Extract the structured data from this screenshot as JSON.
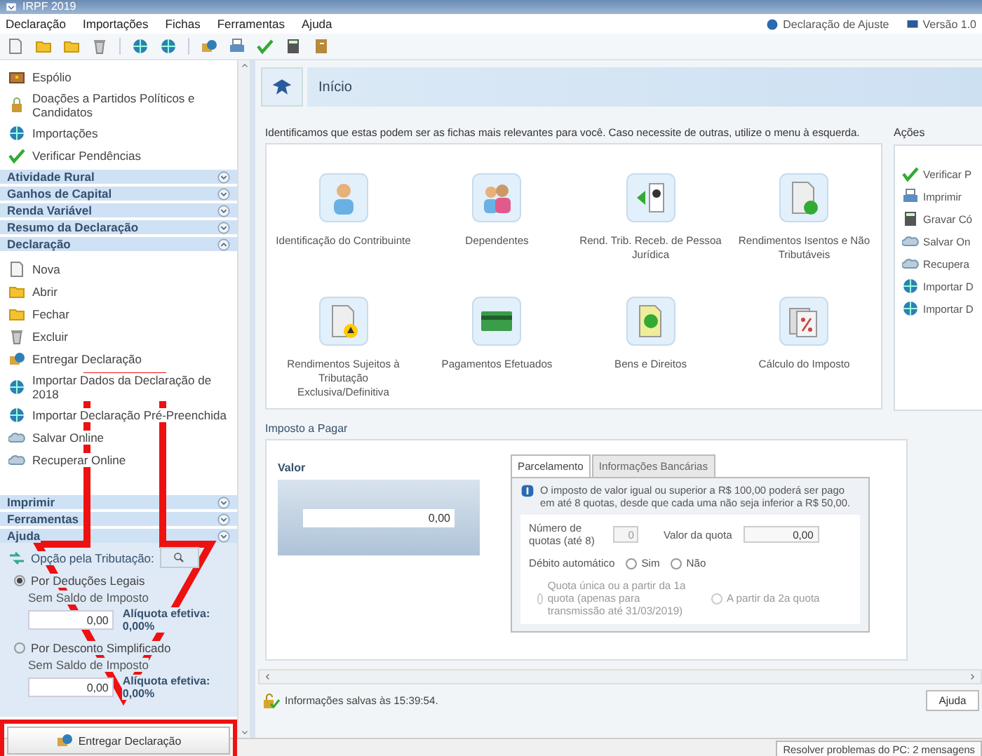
{
  "window": {
    "title": "IRPF 2019"
  },
  "menu": [
    "Declaração",
    "Importações",
    "Fichas",
    "Ferramentas",
    "Ajuda"
  ],
  "header_links": [
    "Declaração de Ajuste",
    "Versão 1.0"
  ],
  "sidebar": {
    "items_above": [
      "Espólio",
      "Doações a Partidos Políticos e Candidatos",
      "Importações",
      "Verificar Pendências"
    ],
    "sections": [
      {
        "label": "Atividade Rural",
        "expanded": false
      },
      {
        "label": "Ganhos de Capital",
        "expanded": false
      },
      {
        "label": "Renda Variável",
        "expanded": false
      },
      {
        "label": "Resumo da Declaração",
        "expanded": false
      },
      {
        "label": "Declaração",
        "expanded": true,
        "items": [
          "Nova",
          "Abrir",
          "Fechar",
          "Excluir",
          "Entregar Declaração",
          "Importar Dados da Declaração de 2018",
          "Importar Declaração Pré-Preenchida",
          "Salvar Online",
          "Recuperar Online"
        ]
      },
      {
        "label": "Imprimir",
        "expanded": false
      },
      {
        "label": "Ferramentas",
        "expanded": false
      },
      {
        "label": "Ajuda",
        "expanded": false
      }
    ]
  },
  "taxation": {
    "title": "Opção pela Tributação:",
    "options": [
      {
        "label": "Por Deduções Legais",
        "selected": true,
        "sublabel": "Sem Saldo de Imposto",
        "value": "0,00",
        "rate": "Alíquota efetiva: 0,00%"
      },
      {
        "label": "Por Desconto Simplificado",
        "selected": false,
        "sublabel": "Sem Saldo de Imposto",
        "value": "0,00",
        "rate": "Alíquota efetiva: 0,00%"
      }
    ],
    "submit": "Entregar Declaração"
  },
  "page_title": "Início",
  "intro": "Identificamos que estas podem ser as fichas mais relevantes para você. Caso necessite de outras, utilize o menu à esquerda.",
  "cards": [
    "Identificação do Contribuinte",
    "Dependentes",
    "Rend. Trib. Receb. de Pessoa Jurídica",
    "Rendimentos Isentos e Não Tributáveis",
    "Rendimentos Sujeitos à Tributação Exclusiva/Definitiva",
    "Pagamentos Efetuados",
    "Bens e Direitos",
    "Cálculo do Imposto"
  ],
  "actions": {
    "title": "Ações",
    "items": [
      "Verificar P",
      "Imprimir",
      "Gravar Có",
      "Salvar On",
      "Recupera",
      "Importar D",
      "Importar D"
    ]
  },
  "tax": {
    "title": "Imposto a Pagar",
    "value_label": "Valor",
    "value": "0,00",
    "tabs": [
      {
        "label": "Parcelamento",
        "selected": true
      },
      {
        "label": "Informações Bancárias",
        "selected": false
      }
    ],
    "notice": "O imposto de valor igual ou superior a R$ 100,00 poderá ser pago em até 8 quotas, desde que cada uma não seja inferior a R$ 50,00.",
    "quotas_label": "Número de quotas (até 8)",
    "quotas": "0",
    "quota_value_label": "Valor da quota",
    "quota_value": "0,00",
    "debit_label": "Débito automático",
    "debit_options": [
      {
        "label": "Sim",
        "selected": false
      },
      {
        "label": "Não",
        "selected": false
      }
    ],
    "first_quota_options": [
      {
        "label": "Quota única ou a partir da 1a quota (apenas para transmissão até 31/03/2019)",
        "selected": false,
        "disabled": true
      },
      {
        "label": "A partir da 2a quota",
        "selected": false,
        "disabled": true
      }
    ]
  },
  "status": {
    "message": "Informações salvas às 15:39:54.",
    "help_button": "Ajuda"
  },
  "problems": "Resolver problemas do PC: 2 mensagens"
}
